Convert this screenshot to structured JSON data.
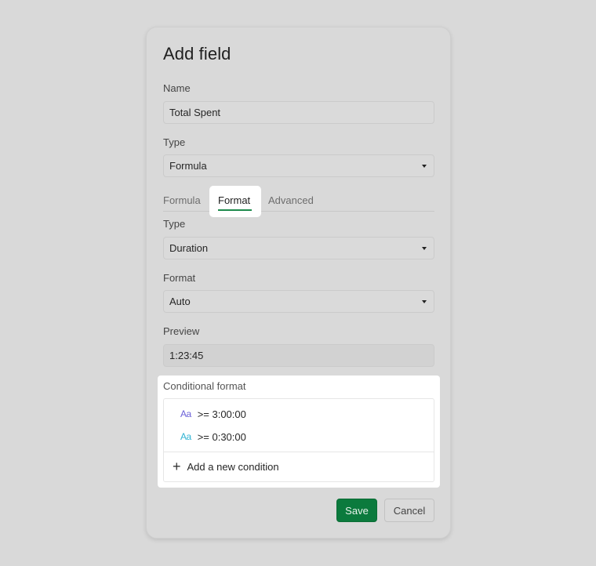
{
  "dialog": {
    "title": "Add field",
    "name_label": "Name",
    "name_value": "Total Spent",
    "type_label": "Type",
    "type_value": "Formula",
    "tabs": [
      {
        "label": "Formula",
        "active": false
      },
      {
        "label": "Format",
        "active": true
      },
      {
        "label": "Advanced",
        "active": false
      }
    ],
    "format_type_label": "Type",
    "format_type_value": "Duration",
    "format_label": "Format",
    "format_value": "Auto",
    "preview_label": "Preview",
    "preview_value": "1:23:45",
    "conditional_format": {
      "label": "Conditional format",
      "conditions": [
        {
          "icon": "Aa",
          "icon_color": "#6a5fd8",
          "text": ">= 3:00:00"
        },
        {
          "icon": "Aa",
          "icon_color": "#2fb3d3",
          "text": ">= 0:30:00"
        }
      ],
      "add_label": "Add a new condition",
      "add_icon": "+"
    },
    "buttons": {
      "save": "Save",
      "cancel": "Cancel"
    },
    "colors": {
      "accent": "#0b7a3d",
      "tab_underline": "#1e8a4c"
    }
  }
}
